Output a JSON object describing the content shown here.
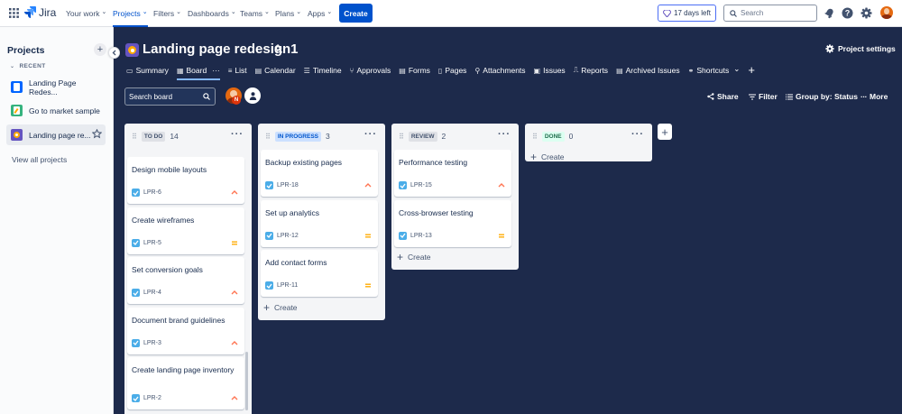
{
  "topbar": {
    "logo_text": "Jira",
    "nav": [
      {
        "label": "Your work",
        "chevron": true
      },
      {
        "label": "Projects",
        "chevron": true,
        "active": true
      },
      {
        "label": "Filters",
        "chevron": true
      },
      {
        "label": "Dashboards",
        "chevron": true
      },
      {
        "label": "Teams",
        "chevron": true
      },
      {
        "label": "Plans",
        "chevron": true
      },
      {
        "label": "Apps",
        "chevron": true
      }
    ],
    "create_label": "Create",
    "trial_label": "17 days left",
    "search_placeholder": "Search",
    "icons": [
      "app-switcher-icon",
      "notifications-icon",
      "help-icon",
      "settings-icon",
      "profile-avatar"
    ]
  },
  "sidebar": {
    "title": "Projects",
    "recent_label": "RECENT",
    "items": [
      {
        "label": "Landing Page Redes...",
        "icon": "project-icon-blue"
      },
      {
        "label": "Go to market sample",
        "icon": "project-icon-green"
      },
      {
        "label": "Landing page re...",
        "icon": "project-icon-purple",
        "selected": true,
        "starred": false
      }
    ],
    "view_all": "View all projects"
  },
  "project": {
    "title": "Landing page redesign1",
    "settings_label": "Project settings",
    "tabs": [
      {
        "label": "Summary",
        "icon": "summary-icon"
      },
      {
        "label": "Board",
        "icon": "board-icon",
        "active": true,
        "more": "···"
      },
      {
        "label": "List",
        "icon": "list-icon"
      },
      {
        "label": "Calendar",
        "icon": "calendar-icon"
      },
      {
        "label": "Timeline",
        "icon": "timeline-icon"
      },
      {
        "label": "Approvals",
        "icon": "approvals-icon"
      },
      {
        "label": "Forms",
        "icon": "forms-icon"
      },
      {
        "label": "Pages",
        "icon": "pages-icon"
      },
      {
        "label": "Attachments",
        "icon": "attachments-icon"
      },
      {
        "label": "Issues",
        "icon": "issues-icon"
      },
      {
        "label": "Reports",
        "icon": "reports-icon"
      },
      {
        "label": "Archived Issues",
        "icon": "archive-icon"
      },
      {
        "label": "Shortcuts",
        "icon": "shortcuts-icon",
        "chevron": true
      },
      {
        "label": "+",
        "icon": "add-tab-icon"
      }
    ]
  },
  "toolbar": {
    "search_placeholder": "Search board",
    "avatar_initial": "N",
    "share_label": "Share",
    "filter_label": "Filter",
    "group_label": "Group by: Status",
    "more_label": "More"
  },
  "columns": [
    {
      "name": "TO DO",
      "count": "14",
      "lozenge_bg": "#dfe1e6",
      "lozenge_fg": "#44546f",
      "cards": [
        {
          "title": "Design mobile layouts",
          "key": "LPR-6",
          "priority": "high"
        },
        {
          "title": "Create wireframes",
          "key": "LPR-5",
          "priority": "medium"
        },
        {
          "title": "Set conversion goals",
          "key": "LPR-4",
          "priority": "high"
        },
        {
          "title": "Document brand guidelines",
          "key": "LPR-3",
          "priority": "high"
        },
        {
          "title": "Create landing page inventory",
          "key": "LPR-2",
          "priority": "high"
        }
      ]
    },
    {
      "name": "IN PROGRESS",
      "count": "3",
      "lozenge_bg": "#cce0ff",
      "lozenge_fg": "#0055cc",
      "cards": [
        {
          "title": "Backup existing pages",
          "key": "LPR-18",
          "priority": "high"
        },
        {
          "title": "Set up analytics",
          "key": "LPR-12",
          "priority": "medium"
        },
        {
          "title": "Add contact forms",
          "key": "LPR-11",
          "priority": "medium"
        }
      ],
      "create_label": "Create"
    },
    {
      "name": "REVIEW",
      "count": "2",
      "lozenge_bg": "#dfe1e6",
      "lozenge_fg": "#44546f",
      "cards": [
        {
          "title": "Performance testing",
          "key": "LPR-15",
          "priority": "high"
        },
        {
          "title": "Cross-browser testing",
          "key": "LPR-13",
          "priority": "medium"
        }
      ],
      "create_label": "Create"
    },
    {
      "name": "DONE",
      "count": "0",
      "lozenge_bg": "#dcfff1",
      "lozenge_fg": "#216e4e",
      "cards": [],
      "create_label": "Create"
    }
  ],
  "colors": {
    "board_bg": "#1d2a4b",
    "brand": "#0052cc",
    "priority_high": "#ff7452",
    "priority_medium": "#ffab00",
    "task_icon": "#4bade8"
  }
}
